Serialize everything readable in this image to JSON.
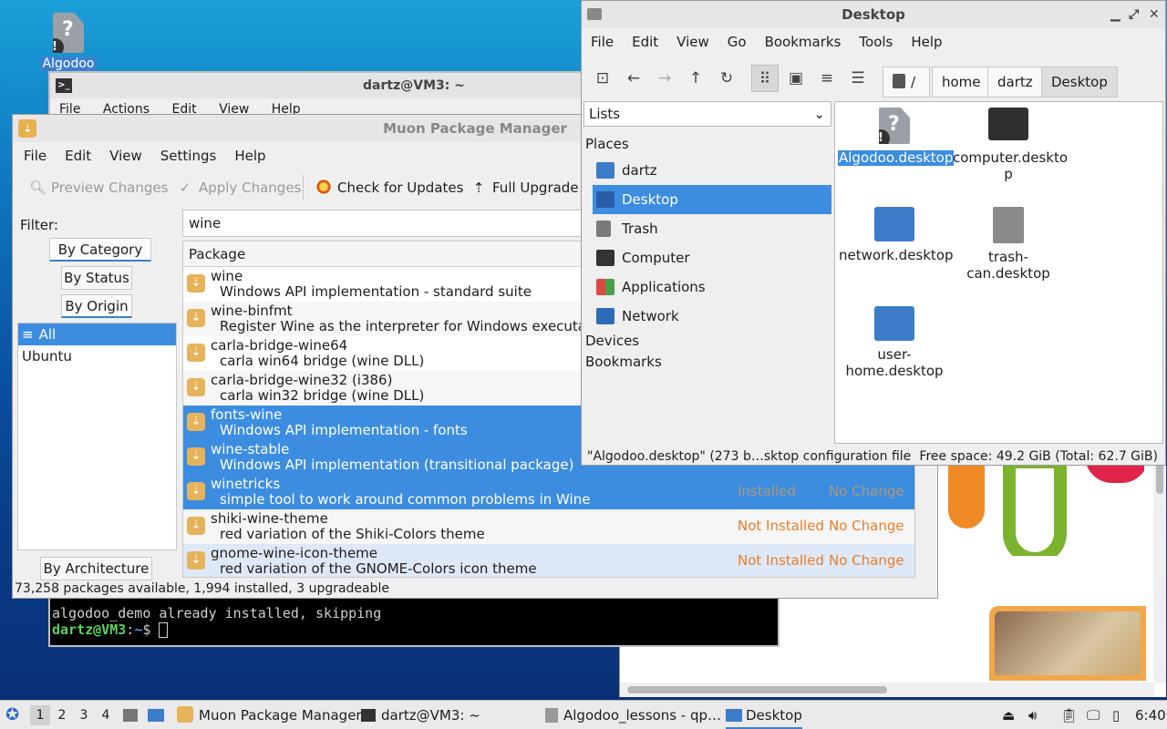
{
  "desktop": {
    "algodoo_label": "Algodoo"
  },
  "terminal": {
    "title": "dartz@VM3: ~",
    "menu": [
      "File",
      "Actions",
      "Edit",
      "View",
      "Help"
    ],
    "line1": "algodoo_demo already installed, skipping",
    "prompt_user": "dartz@VM3",
    "prompt_sep": ":",
    "prompt_path": "~",
    "prompt_end": "$"
  },
  "muon": {
    "title": "Muon Package Manager",
    "menu": [
      "File",
      "Edit",
      "View",
      "Settings",
      "Help"
    ],
    "toolbar": {
      "preview": "Preview Changes",
      "apply": "Apply Changes",
      "check": "Check for Updates",
      "upgrade": "Full Upgrade"
    },
    "filter_label": "Filter:",
    "filter_value": "wine",
    "tabs": [
      "By Category",
      "By Status",
      "By Origin",
      "By Architecture"
    ],
    "origins": [
      "All",
      "Ubuntu"
    ],
    "column_package": "Package",
    "packages": [
      {
        "name": "wine",
        "desc": "Windows API implementation - standard suite",
        "status": "",
        "action": ""
      },
      {
        "name": "wine-binfmt",
        "desc": "Register Wine as the interpreter for Windows executables",
        "status": "",
        "action": ""
      },
      {
        "name": "carla-bridge-wine64",
        "desc": "carla win64 bridge (wine DLL)",
        "status": "",
        "action": ""
      },
      {
        "name": "carla-bridge-wine32 (i386)",
        "desc": "carla win32 bridge (wine DLL)",
        "status": "",
        "action": ""
      },
      {
        "name": "fonts-wine",
        "desc": "Windows API implementation - fonts",
        "status": "",
        "action": ""
      },
      {
        "name": "wine-stable",
        "desc": "Windows API implementation (transitional package)",
        "status": "",
        "action": ""
      },
      {
        "name": "winetricks",
        "desc": "simple tool to work around common problems in Wine",
        "status": "Installed",
        "action": "No Change"
      },
      {
        "name": "shiki-wine-theme",
        "desc": "red variation of the Shiki-Colors theme",
        "status": "Not Installed",
        "action": "No Change"
      },
      {
        "name": "gnome-wine-icon-theme",
        "desc": "red variation of the GNOME-Colors icon theme",
        "status": "Not Installed",
        "action": "No Change"
      }
    ],
    "status_bar": "73,258 packages available, 1,994 installed, 3 upgradeable"
  },
  "file_manager": {
    "title": "Desktop",
    "menu": [
      "File",
      "Edit",
      "View",
      "Go",
      "Bookmarks",
      "Tools",
      "Help"
    ],
    "path": [
      "/",
      "home",
      "dartz",
      "Desktop"
    ],
    "side_mode": "Lists",
    "places_header": "Places",
    "places": [
      "dartz",
      "Desktop",
      "Trash",
      "Computer",
      "Applications",
      "Network"
    ],
    "devices_header": "Devices",
    "bookmarks_header": "Bookmarks",
    "files": [
      {
        "line1": "Algodoo.desktop",
        "line2": ""
      },
      {
        "line1": "computer.deskto",
        "line2": "p"
      },
      {
        "line1": "network.desktop",
        "line2": ""
      },
      {
        "line1": "trash-",
        "line2": "can.desktop"
      },
      {
        "line1": "user-",
        "line2": "home.desktop"
      }
    ],
    "status_left": "\"Algodoo.desktop\" (273 b…sktop configuration file",
    "status_right": "Free space: 49.2 GiB (Total: 62.7 GiB)"
  },
  "taskbar": {
    "workspaces": [
      "1",
      "2",
      "3",
      "4"
    ],
    "tasks": [
      "Muon Package Manager",
      "dartz@VM3: ~",
      "Algodoo_lessons - qp…",
      "Desktop"
    ],
    "clock": "6:40"
  },
  "colors": {
    "selection": "#3c8de0",
    "accent": "#3c7fd1",
    "status_orange": "#e87d2a"
  }
}
